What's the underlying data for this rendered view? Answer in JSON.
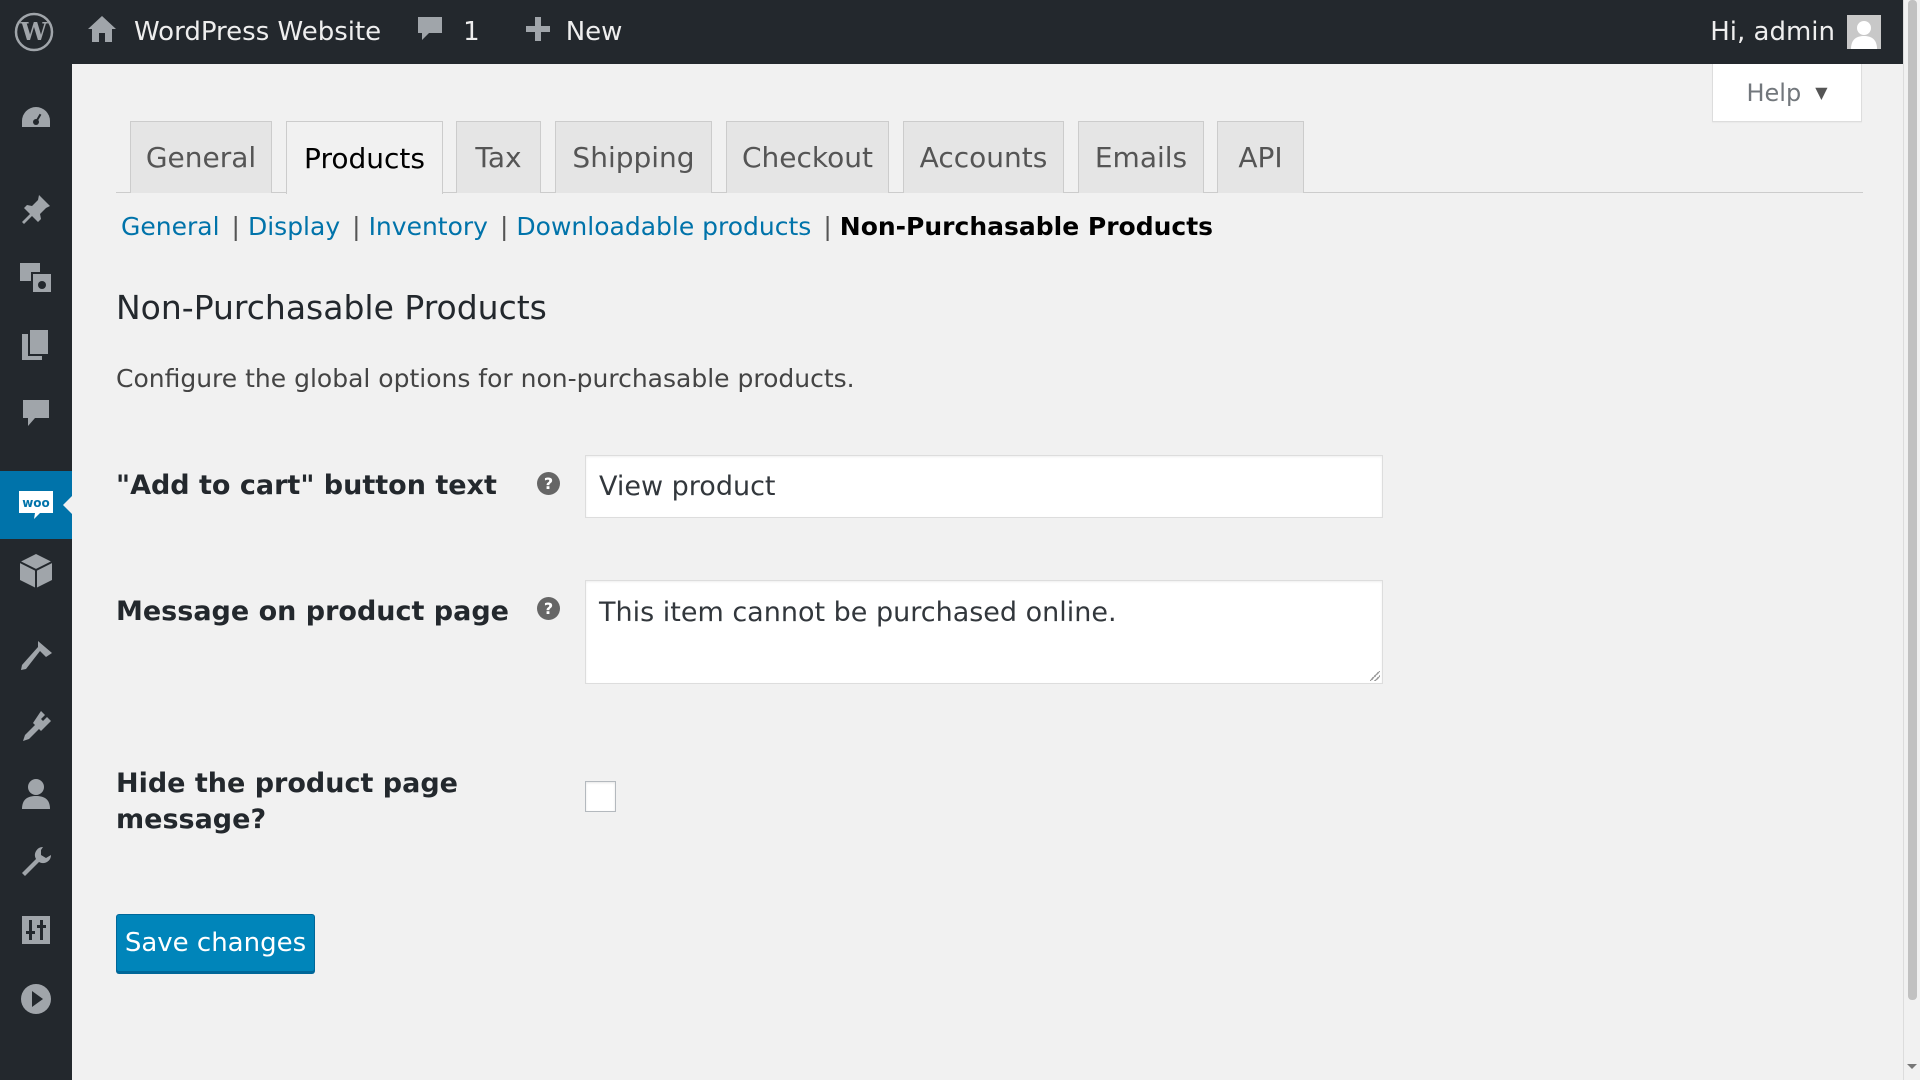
{
  "adminbar": {
    "site_name": "WordPress Website",
    "comments_count": "1",
    "new_label": "New",
    "greeting": "Hi, admin"
  },
  "sidebar": {
    "icons": [
      "dashboard-icon",
      "pin-icon",
      "media-icon",
      "pages-icon",
      "comments-icon",
      "woocommerce-icon",
      "products-icon",
      "appearance-icon",
      "plugins-icon",
      "users-icon",
      "tools-icon",
      "settings-icon",
      "media-play-icon"
    ],
    "woo_label": "woo",
    "current": "woocommerce"
  },
  "help": {
    "label": "Help"
  },
  "tabs": [
    "General",
    "Products",
    "Tax",
    "Shipping",
    "Checkout",
    "Accounts",
    "Emails",
    "API"
  ],
  "active_tab": "Products",
  "subnav": {
    "links": [
      "General",
      "Display",
      "Inventory",
      "Downloadable products"
    ],
    "separator": "|",
    "current": "Non-Purchasable Products"
  },
  "section": {
    "title": "Non-Purchasable Products",
    "description": "Configure the global options for non-purchasable products."
  },
  "fields": {
    "add_to_cart_label": "\"Add to cart\" button text",
    "add_to_cart_value": "View product",
    "message_label": "Message on product page",
    "message_value": "This item cannot be purchased online.",
    "hide_label_line1": "Hide the product page",
    "hide_label_line2": "message?",
    "hide_checked": false,
    "help_tip_glyph": "?"
  },
  "save_label": "Save changes",
  "colors": {
    "adminbar_bg": "#23282d",
    "accent": "#0073aa",
    "button": "#0085ba"
  }
}
